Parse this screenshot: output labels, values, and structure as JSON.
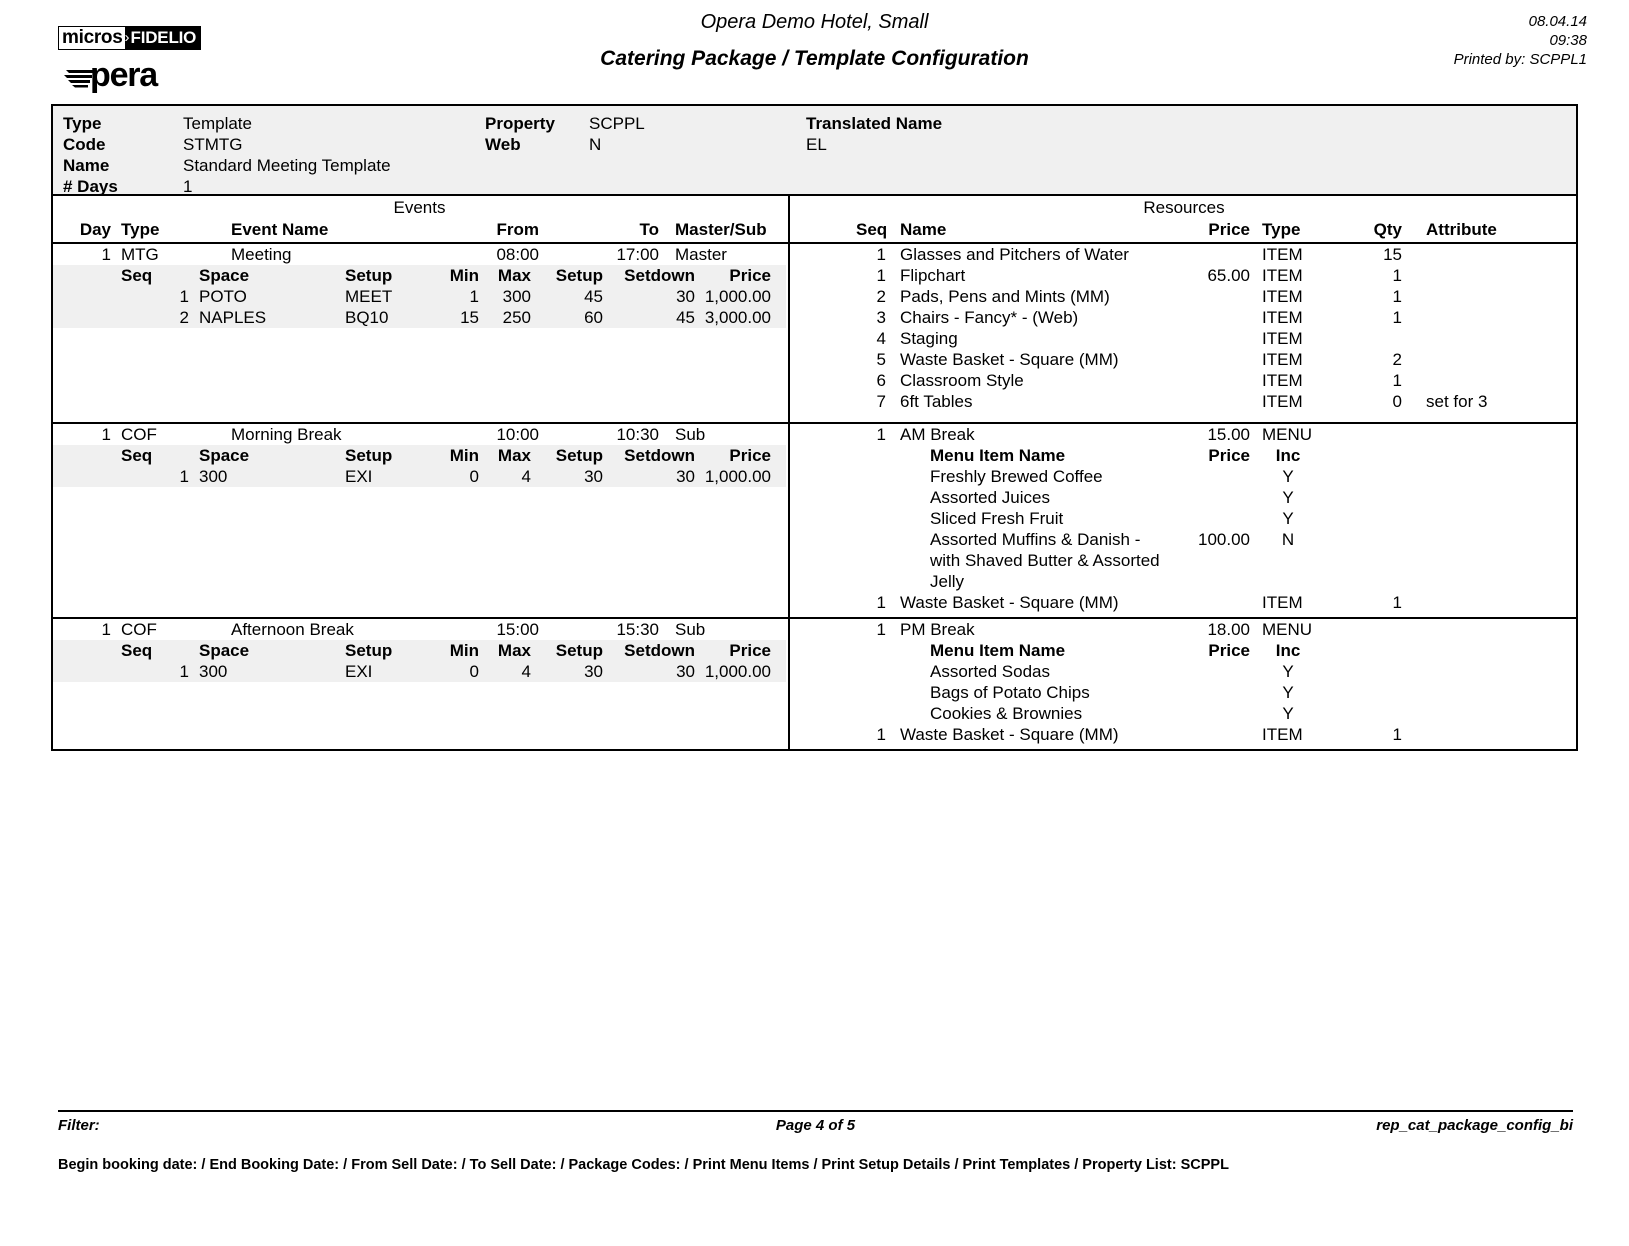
{
  "header": {
    "logo_micros": "micros",
    "logo_arrow": "›",
    "logo_fidelio": "FIDELIO",
    "logo_opera": "pera",
    "hotel_name": "Opera Demo Hotel, Small",
    "report_title": "Catering Package / Template Configuration",
    "print_date": "08.04.14",
    "print_time": "09:38",
    "printed_by": "Printed by: SCPPL1"
  },
  "summary": {
    "type_label": "Type",
    "type_value": "Template",
    "code_label": "Code",
    "code_value": "STMTG",
    "name_label": "Name",
    "name_value": "Standard Meeting Template",
    "days_label": "# Days",
    "days_value": "1",
    "property_label": "Property",
    "property_value": "SCPPL",
    "web_label": "Web",
    "web_value": "N",
    "translated_name_label": "Translated Name",
    "translated_name_value": "EL"
  },
  "events_section": {
    "title": "Events",
    "headers": {
      "day": "Day",
      "type": "Type",
      "event_name": "Event Name",
      "from": "From",
      "to": "To",
      "master_sub": "Master/Sub"
    },
    "space_headers": {
      "seq": "Seq",
      "space": "Space",
      "setup": "Setup",
      "min": "Min",
      "max": "Max",
      "setup_time": "Setup",
      "setdown": "Setdown",
      "price": "Price"
    }
  },
  "resources_section": {
    "title": "Resources",
    "headers": {
      "seq": "Seq",
      "name": "Name",
      "price": "Price",
      "type": "Type",
      "qty": "Qty",
      "attribute": "Attribute"
    },
    "menu_headers": {
      "menu_item_name": "Menu Item Name",
      "price": "Price",
      "inc": "Inc"
    }
  },
  "groups": [
    {
      "event": {
        "day": "1",
        "type": "MTG",
        "name": "Meeting",
        "from": "08:00",
        "to": "17:00",
        "master_sub": "Master"
      },
      "spaces": [
        {
          "seq": "1",
          "space": "POTO",
          "setup": "MEET",
          "min": "1",
          "max": "300",
          "setup_time": "45",
          "setdown": "30",
          "price": "1,000.00"
        },
        {
          "seq": "2",
          "space": "NAPLES",
          "setup": "BQ10",
          "min": "15",
          "max": "250",
          "setup_time": "60",
          "setdown": "45",
          "price": "3,000.00"
        }
      ],
      "resources": [
        {
          "seq": "1",
          "name": "Glasses and Pitchers of Water",
          "price": "",
          "type": "ITEM",
          "qty": "15",
          "attribute": "",
          "menu_items": []
        },
        {
          "seq": "1",
          "name": "Flipchart",
          "price": "65.00",
          "type": "ITEM",
          "qty": "1",
          "attribute": "",
          "menu_items": []
        },
        {
          "seq": "2",
          "name": "Pads, Pens and Mints (MM)",
          "price": "",
          "type": "ITEM",
          "qty": "1",
          "attribute": "",
          "menu_items": []
        },
        {
          "seq": "3",
          "name": "Chairs - Fancy* - (Web)",
          "price": "",
          "type": "ITEM",
          "qty": "1",
          "attribute": "",
          "menu_items": []
        },
        {
          "seq": "4",
          "name": "Staging",
          "price": "",
          "type": "ITEM",
          "qty": "",
          "attribute": "",
          "menu_items": []
        },
        {
          "seq": "5",
          "name": "Waste Basket - Square (MM)",
          "price": "",
          "type": "ITEM",
          "qty": "2",
          "attribute": "",
          "menu_items": []
        },
        {
          "seq": "6",
          "name": "Classroom Style",
          "price": "",
          "type": "ITEM",
          "qty": "1",
          "attribute": "",
          "menu_items": []
        },
        {
          "seq": "7",
          "name": "6ft Tables",
          "price": "",
          "type": "ITEM",
          "qty": "0",
          "attribute": "set for 3",
          "menu_items": []
        }
      ]
    },
    {
      "event": {
        "day": "1",
        "type": "COF",
        "name": "Morning Break",
        "from": "10:00",
        "to": "10:30",
        "master_sub": "Sub"
      },
      "spaces": [
        {
          "seq": "1",
          "space": "300",
          "setup": "EXI",
          "min": "0",
          "max": "4",
          "setup_time": "30",
          "setdown": "30",
          "price": "1,000.00"
        }
      ],
      "resources": [
        {
          "seq": "1",
          "name": "AM Break",
          "price": "15.00",
          "type": "MENU",
          "qty": "",
          "attribute": "",
          "menu_items": [
            {
              "name": "Freshly Brewed Coffee",
              "price": "",
              "inc": "Y"
            },
            {
              "name": "Assorted Juices",
              "price": "",
              "inc": "Y"
            },
            {
              "name": "Sliced Fresh Fruit",
              "price": "",
              "inc": "Y"
            },
            {
              "name": "Assorted Muffins & Danish -",
              "price": "100.00",
              "inc": "N"
            },
            {
              "name": "with Shaved Butter & Assorted",
              "price": "",
              "inc": ""
            },
            {
              "name": "Jelly",
              "price": "",
              "inc": ""
            }
          ]
        },
        {
          "seq": "1",
          "name": "Waste Basket - Square (MM)",
          "price": "",
          "type": "ITEM",
          "qty": "1",
          "attribute": "",
          "menu_items": []
        }
      ]
    },
    {
      "event": {
        "day": "1",
        "type": "COF",
        "name": "Afternoon Break",
        "from": "15:00",
        "to": "15:30",
        "master_sub": "Sub"
      },
      "spaces": [
        {
          "seq": "1",
          "space": "300",
          "setup": "EXI",
          "min": "0",
          "max": "4",
          "setup_time": "30",
          "setdown": "30",
          "price": "1,000.00"
        }
      ],
      "resources": [
        {
          "seq": "1",
          "name": "PM Break",
          "price": "18.00",
          "type": "MENU",
          "qty": "",
          "attribute": "",
          "menu_items": [
            {
              "name": "Assorted Sodas",
              "price": "",
              "inc": "Y"
            },
            {
              "name": "Bags of Potato Chips",
              "price": "",
              "inc": "Y"
            },
            {
              "name": "Cookies & Brownies",
              "price": "",
              "inc": "Y"
            }
          ]
        },
        {
          "seq": "1",
          "name": "Waste Basket - Square (MM)",
          "price": "",
          "type": "ITEM",
          "qty": "1",
          "attribute": "",
          "menu_items": []
        }
      ]
    }
  ],
  "footer": {
    "filter_label": "Filter:",
    "page_label": "Page 4 of 5",
    "report_id": "rep_cat_package_config_bi",
    "params": "Begin booking date:  / End Booking Date:  / From Sell Date:  / To Sell Date:  / Package Codes:  / Print Menu Items / Print Setup Details / Print Templates / Property List: SCPPL"
  }
}
